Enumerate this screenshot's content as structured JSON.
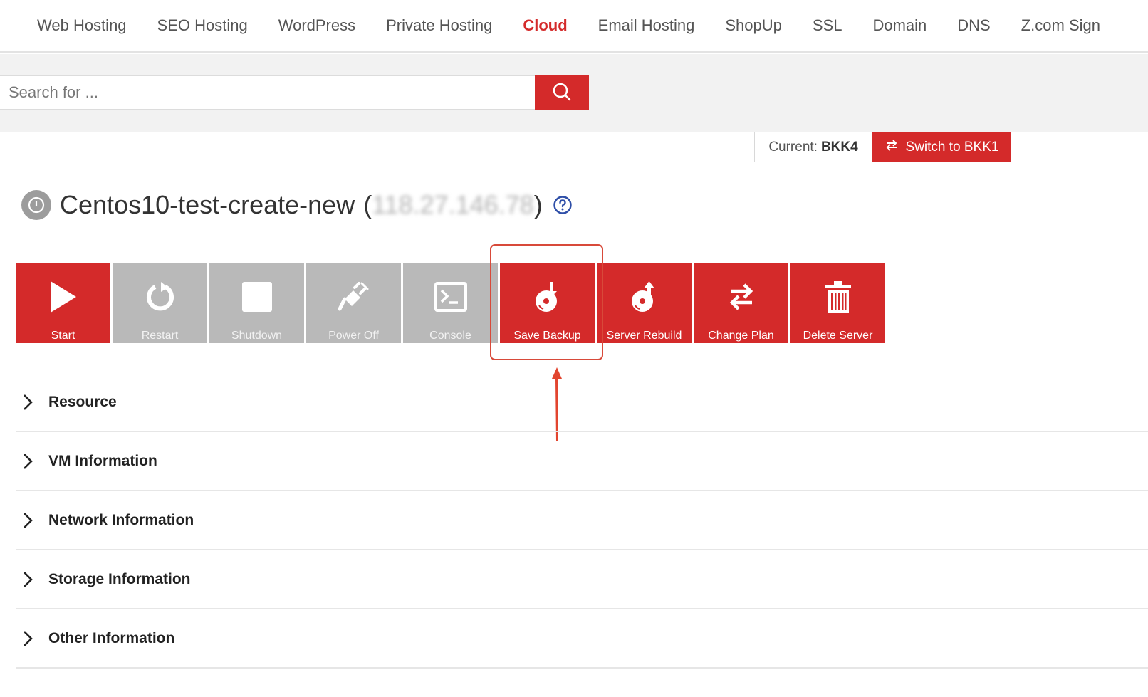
{
  "nav": {
    "items": [
      {
        "label": "Web Hosting",
        "active": false
      },
      {
        "label": "SEO Hosting",
        "active": false
      },
      {
        "label": "WordPress",
        "active": false
      },
      {
        "label": "Private Hosting",
        "active": false
      },
      {
        "label": "Cloud",
        "active": true
      },
      {
        "label": "Email Hosting",
        "active": false
      },
      {
        "label": "ShopUp",
        "active": false
      },
      {
        "label": "SSL",
        "active": false
      },
      {
        "label": "Domain",
        "active": false
      },
      {
        "label": "DNS",
        "active": false
      },
      {
        "label": "Z.com Sign",
        "active": false
      }
    ]
  },
  "search": {
    "placeholder": "Search for ...",
    "value": "",
    "button_icon": "search-icon"
  },
  "datacenter": {
    "current_label": "Current:",
    "current_value": "BKK4",
    "switch_label": "Switch to BKK1",
    "switch_icon": "swap-arrows-icon"
  },
  "server": {
    "name": "Centos10-test-create-new",
    "ip_open": "(",
    "ip": "118.27.146.78",
    "ip_close": ")",
    "status_icon": "power-status-icon",
    "help_icon": "help-icon"
  },
  "actions": [
    {
      "label": "Start",
      "icon": "play-icon",
      "enabled": true
    },
    {
      "label": "Restart",
      "icon": "restart-icon",
      "enabled": false
    },
    {
      "label": "Shutdown",
      "icon": "stop-icon",
      "enabled": false
    },
    {
      "label": "Power Off",
      "icon": "plug-off-icon",
      "enabled": false
    },
    {
      "label": "Console",
      "icon": "terminal-icon",
      "enabled": false
    },
    {
      "label": "Save Backup",
      "icon": "disc-backup-icon",
      "enabled": true
    },
    {
      "label": "Server Rebuild",
      "icon": "disc-rebuild-icon",
      "enabled": true
    },
    {
      "label": "Change Plan",
      "icon": "swap-arrows-icon",
      "enabled": true
    },
    {
      "label": "Delete Server",
      "icon": "trash-icon",
      "enabled": true
    }
  ],
  "sections": [
    {
      "label": "Resource"
    },
    {
      "label": "VM Information"
    },
    {
      "label": "Network Information"
    },
    {
      "label": "Storage Information"
    },
    {
      "label": "Other Information"
    }
  ],
  "colors": {
    "brand_red": "#d42a2a",
    "disabled_grey": "#b9b9b9",
    "annotation": "#d84a3a"
  }
}
